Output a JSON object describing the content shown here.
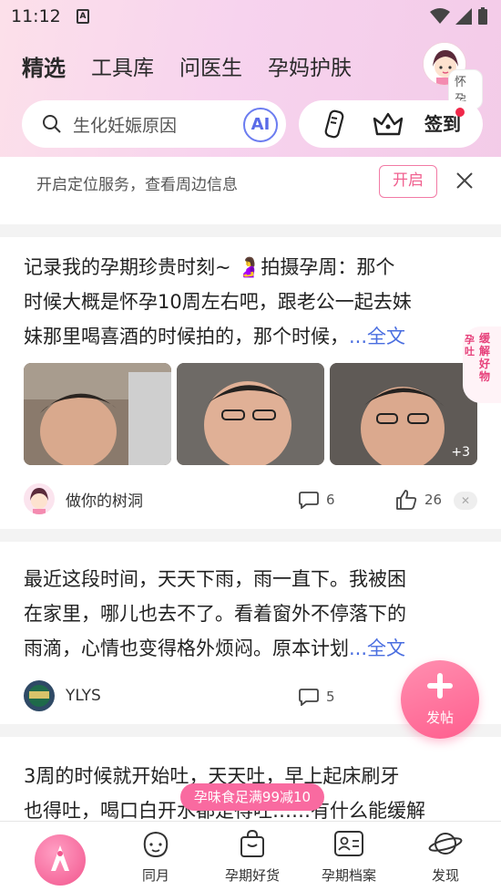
{
  "status_bar": {
    "time": "11:12",
    "notif_letter": "A"
  },
  "tabs": [
    {
      "label": "精选",
      "active": true
    },
    {
      "label": "工具库"
    },
    {
      "label": "问医生"
    },
    {
      "label": "孕妈护肤"
    }
  ],
  "profile": {
    "tag": "怀孕"
  },
  "search": {
    "placeholder": "生化妊娠原因",
    "ai_label": "AI"
  },
  "tools": {
    "checkin_label": "签到"
  },
  "location_bar": {
    "text": "开启定位服务，查看周边信息",
    "open_label": "开启"
  },
  "posts": [
    {
      "line1": "记录我的孕期珍贵时刻~ 🤰拍摄孕周：那个",
      "line2": "时候大概是怀孕10周左右吧，跟老公一起去妹",
      "line3": "妹那里喝喜酒的时候拍的，那个时候，",
      "more": "...全文",
      "extra_photos": "+3",
      "author": "做你的树洞",
      "comments": "6",
      "likes": "26"
    },
    {
      "line1": "最近这段时间，天天下雨，雨一直下。我被困",
      "line2": "在家里，哪儿也去不了。看着窗外不停落下的",
      "line3": "雨滴，心情也变得格外烦闷。原本计划",
      "more": "...全文",
      "author": "YLYS",
      "comments": "5"
    },
    {
      "line1": "3周的时候就开始吐，天天吐，早上起床刷牙",
      "line2": "也得吐，喝口白开水都是得吐……有什么能缓解"
    }
  ],
  "side_promo": {
    "text_a": "缓解好物",
    "text_b": "孕吐"
  },
  "fab": {
    "label": "发帖"
  },
  "promo_pill": "孕味食足满99减10",
  "bottom_nav": [
    {
      "label": ""
    },
    {
      "label": "同月"
    },
    {
      "label": "孕期好货"
    },
    {
      "label": "孕期档案"
    },
    {
      "label": "发现"
    }
  ],
  "colors": {
    "accent": "#f0608f",
    "link": "#4a6ee0",
    "ai": "#5a6be8"
  }
}
